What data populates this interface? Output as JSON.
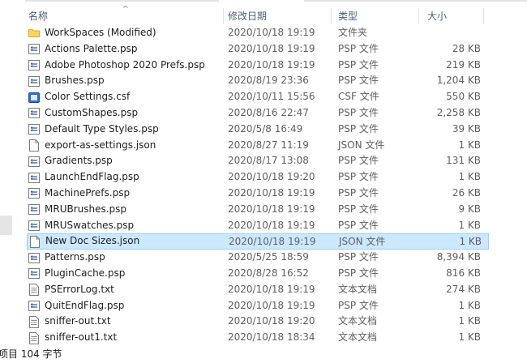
{
  "columns": {
    "name": "名称",
    "date": "修改日期",
    "type": "类型",
    "size": "大小"
  },
  "files": [
    {
      "name": "WorkSpaces (Modified)",
      "date": "2020/10/18 19:19",
      "type": "文件夹",
      "size": "",
      "icon": "folder-icon"
    },
    {
      "name": "Actions Palette.psp",
      "date": "2020/10/18 19:19",
      "type": "PSP 文件",
      "size": "28 KB",
      "icon": "psp-file-icon"
    },
    {
      "name": "Adobe Photoshop 2020 Prefs.psp",
      "date": "2020/10/18 19:19",
      "type": "PSP 文件",
      "size": "219 KB",
      "icon": "psp-file-icon"
    },
    {
      "name": "Brushes.psp",
      "date": "2020/8/19 23:36",
      "type": "PSP 文件",
      "size": "1,204 KB",
      "icon": "psp-file-icon"
    },
    {
      "name": "Color Settings.csf",
      "date": "2020/10/11 15:56",
      "type": "CSF 文件",
      "size": "550 KB",
      "icon": "csf-file-icon"
    },
    {
      "name": "CustomShapes.psp",
      "date": "2020/8/16 22:47",
      "type": "PSP 文件",
      "size": "2,258 KB",
      "icon": "psp-file-icon"
    },
    {
      "name": "Default Type Styles.psp",
      "date": "2020/5/8 16:49",
      "type": "PSP 文件",
      "size": "39 KB",
      "icon": "psp-file-icon"
    },
    {
      "name": "export-as-settings.json",
      "date": "2020/8/27 11:19",
      "type": "JSON 文件",
      "size": "1 KB",
      "icon": "json-file-icon"
    },
    {
      "name": "Gradients.psp",
      "date": "2020/8/17 13:08",
      "type": "PSP 文件",
      "size": "131 KB",
      "icon": "psp-file-icon"
    },
    {
      "name": "LaunchEndFlag.psp",
      "date": "2020/10/18 19:20",
      "type": "PSP 文件",
      "size": "1 KB",
      "icon": "psp-file-icon"
    },
    {
      "name": "MachinePrefs.psp",
      "date": "2020/10/18 19:19",
      "type": "PSP 文件",
      "size": "26 KB",
      "icon": "psp-file-icon"
    },
    {
      "name": "MRUBrushes.psp",
      "date": "2020/10/18 19:19",
      "type": "PSP 文件",
      "size": "9 KB",
      "icon": "psp-file-icon"
    },
    {
      "name": "MRUSwatches.psp",
      "date": "2020/10/18 19:19",
      "type": "PSP 文件",
      "size": "1 KB",
      "icon": "psp-file-icon"
    },
    {
      "name": "New Doc Sizes.json",
      "date": "2020/10/18 19:19",
      "type": "JSON 文件",
      "size": "1 KB",
      "icon": "json-file-icon",
      "selected": true
    },
    {
      "name": "Patterns.psp",
      "date": "2020/5/25 18:59",
      "type": "PSP 文件",
      "size": "8,394 KB",
      "icon": "psp-file-icon"
    },
    {
      "name": "PluginCache.psp",
      "date": "2020/8/28 16:52",
      "type": "PSP 文件",
      "size": "816 KB",
      "icon": "psp-file-icon"
    },
    {
      "name": "PSErrorLog.txt",
      "date": "2020/10/18 19:19",
      "type": "文本文档",
      "size": "274 KB",
      "icon": "txt-file-icon"
    },
    {
      "name": "QuitEndFlag.psp",
      "date": "2020/10/18 19:19",
      "type": "PSP 文件",
      "size": "1 KB",
      "icon": "psp-file-icon"
    },
    {
      "name": "sniffer-out.txt",
      "date": "2020/10/18 19:20",
      "type": "文本文档",
      "size": "1 KB",
      "icon": "txt-file-icon"
    },
    {
      "name": "sniffer-out1.txt",
      "date": "2020/10/18 18:34",
      "type": "文本文档",
      "size": "1 KB",
      "icon": "txt-file-icon"
    }
  ],
  "status": {
    "count_text": "项目 104 字节"
  },
  "colors": {
    "selection_bg": "#cce8ff",
    "selection_border": "#99d1ff",
    "header_text": "#4c607a",
    "folder": "#ffd35e"
  }
}
